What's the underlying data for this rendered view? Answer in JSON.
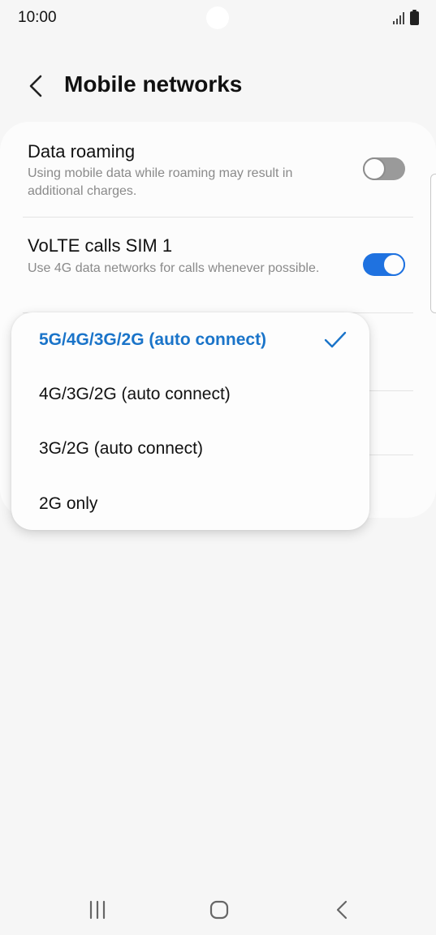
{
  "status_bar": {
    "time": "10:00",
    "icons": [
      "signal-icon",
      "battery-icon"
    ]
  },
  "header": {
    "title": "Mobile networks",
    "back_icon": "back-arrow-icon"
  },
  "settings": [
    {
      "title": "Data roaming",
      "summary": "Using mobile data while roaming may result in additional charges.",
      "toggle_on": false
    },
    {
      "title": "VoLTE calls SIM 1",
      "summary": "Use 4G data networks for calls whenever possible.",
      "toggle_on": true
    }
  ],
  "network_mode_menu": {
    "options": [
      {
        "label": "5G/4G/3G/2G (auto connect)",
        "selected": true
      },
      {
        "label": "4G/3G/2G (auto connect)",
        "selected": false
      },
      {
        "label": "3G/2G (auto connect)",
        "selected": false
      },
      {
        "label": "2G only",
        "selected": false
      }
    ],
    "check_icon": "checkmark-icon"
  },
  "nav_bar": {
    "buttons": [
      "recent-apps-icon",
      "home-icon",
      "back-icon"
    ]
  },
  "colors": {
    "accent": "#1f72e0",
    "selected_text": "#1a74c9",
    "background": "#f6f6f6",
    "card": "#fcfcfc",
    "summary_text": "#8a8a8a"
  }
}
